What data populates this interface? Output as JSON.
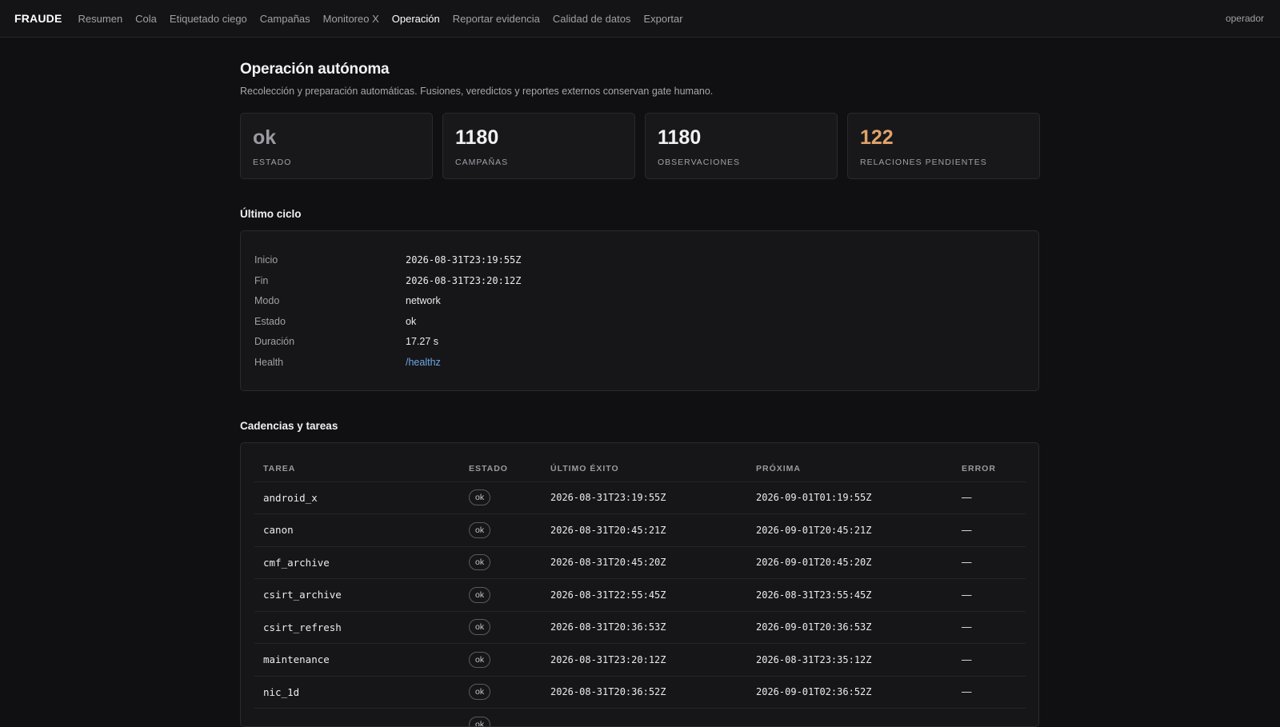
{
  "nav": {
    "brand": "FRAUDE",
    "items": [
      "Resumen",
      "Cola",
      "Etiquetado ciego",
      "Campañas",
      "Monitoreo X",
      "Operación",
      "Reportar evidencia",
      "Calidad de datos",
      "Exportar"
    ],
    "active": "Operación",
    "user": "operador"
  },
  "page": {
    "title": "Operación autónoma",
    "subtitle": "Recolección y preparación automáticas. Fusiones, veredictos y reportes externos conservan gate humano."
  },
  "stats": [
    {
      "value": "ok",
      "label": "ESTADO"
    },
    {
      "value": "1180",
      "label": "CAMPAÑAS"
    },
    {
      "value": "1180",
      "label": "OBSERVACIONES"
    },
    {
      "value": "122",
      "label": "RELACIONES PENDIENTES"
    }
  ],
  "colors": {
    "warn": "#e0a36a",
    "link": "#6fa6e8"
  },
  "cycle": {
    "heading": "Último ciclo",
    "rows": [
      {
        "key": "Inicio",
        "value": "2026-08-31T23:19:55Z"
      },
      {
        "key": "Fin",
        "value": "2026-08-31T23:20:12Z"
      },
      {
        "key": "Modo",
        "value": "network"
      },
      {
        "key": "Estado",
        "value": "ok"
      },
      {
        "key": "Duración",
        "value": "17.27 s"
      },
      {
        "key": "Health",
        "value": "/healthz"
      }
    ]
  },
  "tasks": {
    "heading": "Cadencias y tareas",
    "columns": [
      "TAREA",
      "ESTADO",
      "ÚLTIMO ÉXITO",
      "PRÓXIMA",
      "ERROR"
    ],
    "rows": [
      {
        "name": "android_x",
        "status": "ok",
        "last": "2026-08-31T23:19:55Z",
        "next": "2026-09-01T01:19:55Z",
        "error": "—"
      },
      {
        "name": "canon",
        "status": "ok",
        "last": "2026-08-31T20:45:21Z",
        "next": "2026-09-01T20:45:21Z",
        "error": "—"
      },
      {
        "name": "cmf_archive",
        "status": "ok",
        "last": "2026-08-31T20:45:20Z",
        "next": "2026-09-01T20:45:20Z",
        "error": "—"
      },
      {
        "name": "csirt_archive",
        "status": "ok",
        "last": "2026-08-31T22:55:45Z",
        "next": "2026-08-31T23:55:45Z",
        "error": "—"
      },
      {
        "name": "csirt_refresh",
        "status": "ok",
        "last": "2026-08-31T20:36:53Z",
        "next": "2026-09-01T20:36:53Z",
        "error": "—"
      },
      {
        "name": "maintenance",
        "status": "ok",
        "last": "2026-08-31T23:20:12Z",
        "next": "2026-08-31T23:35:12Z",
        "error": "—"
      },
      {
        "name": "nic_1d",
        "status": "ok",
        "last": "2026-08-31T20:36:52Z",
        "next": "2026-09-01T02:36:52Z",
        "error": "—"
      },
      {
        "name": "",
        "status": "ok",
        "last": "",
        "next": "",
        "error": ""
      }
    ]
  }
}
